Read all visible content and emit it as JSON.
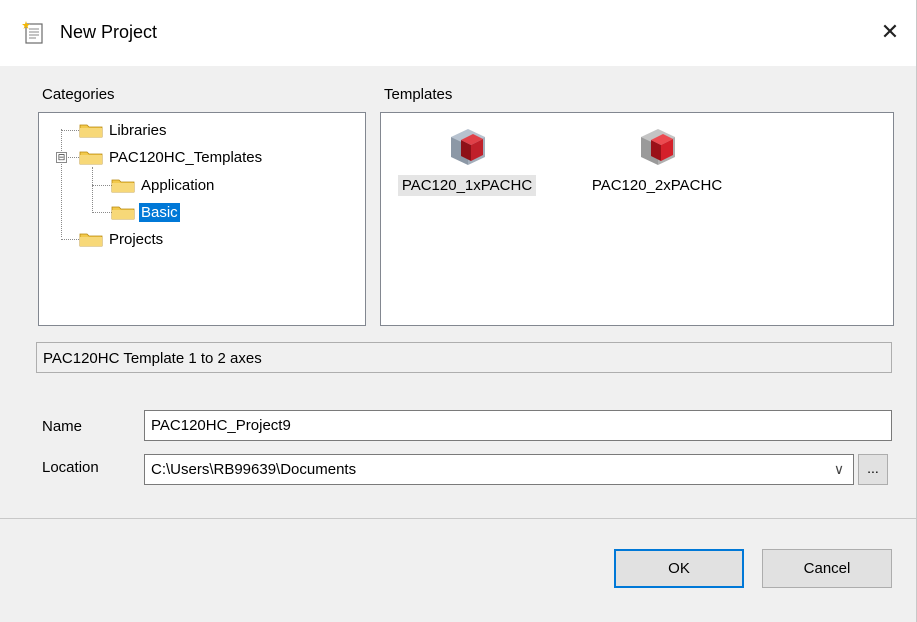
{
  "window": {
    "title": "New Project",
    "close_label": "✕",
    "icon": "new-project-icon"
  },
  "categories": {
    "label": "Categories",
    "tree": [
      {
        "label": "Libraries",
        "level": 0
      },
      {
        "label": "PAC120HC_Templates",
        "level": 0,
        "expanded": true,
        "expander": "⊟"
      },
      {
        "label": "Application",
        "level": 1
      },
      {
        "label": "Basic",
        "level": 1,
        "selected": true
      },
      {
        "label": "Projects",
        "level": 0
      }
    ]
  },
  "templates": {
    "label": "Templates",
    "items": [
      {
        "label": "PAC120_1xPACHC",
        "selected": true,
        "icon": "template-cube-icon"
      },
      {
        "label": "PAC120_2xPACHC",
        "selected": false,
        "icon": "template-cube-icon"
      }
    ]
  },
  "description": "PAC120HC Template 1 to 2 axes",
  "form": {
    "name_label": "Name",
    "name_value": "PAC120HC_Project9",
    "location_label": "Location",
    "location_value": "C:\\Users\\RB99639\\Documents",
    "dropdown_arrow": "∨",
    "browse_label": "..."
  },
  "buttons": {
    "ok": "OK",
    "cancel": "Cancel"
  },
  "colors": {
    "selection": "#0078d7",
    "folder": "#f2c94c",
    "cube_red": "#c0202a",
    "cube_gray": "#9aa6b4",
    "dialog_bg": "#f0f0f0"
  }
}
